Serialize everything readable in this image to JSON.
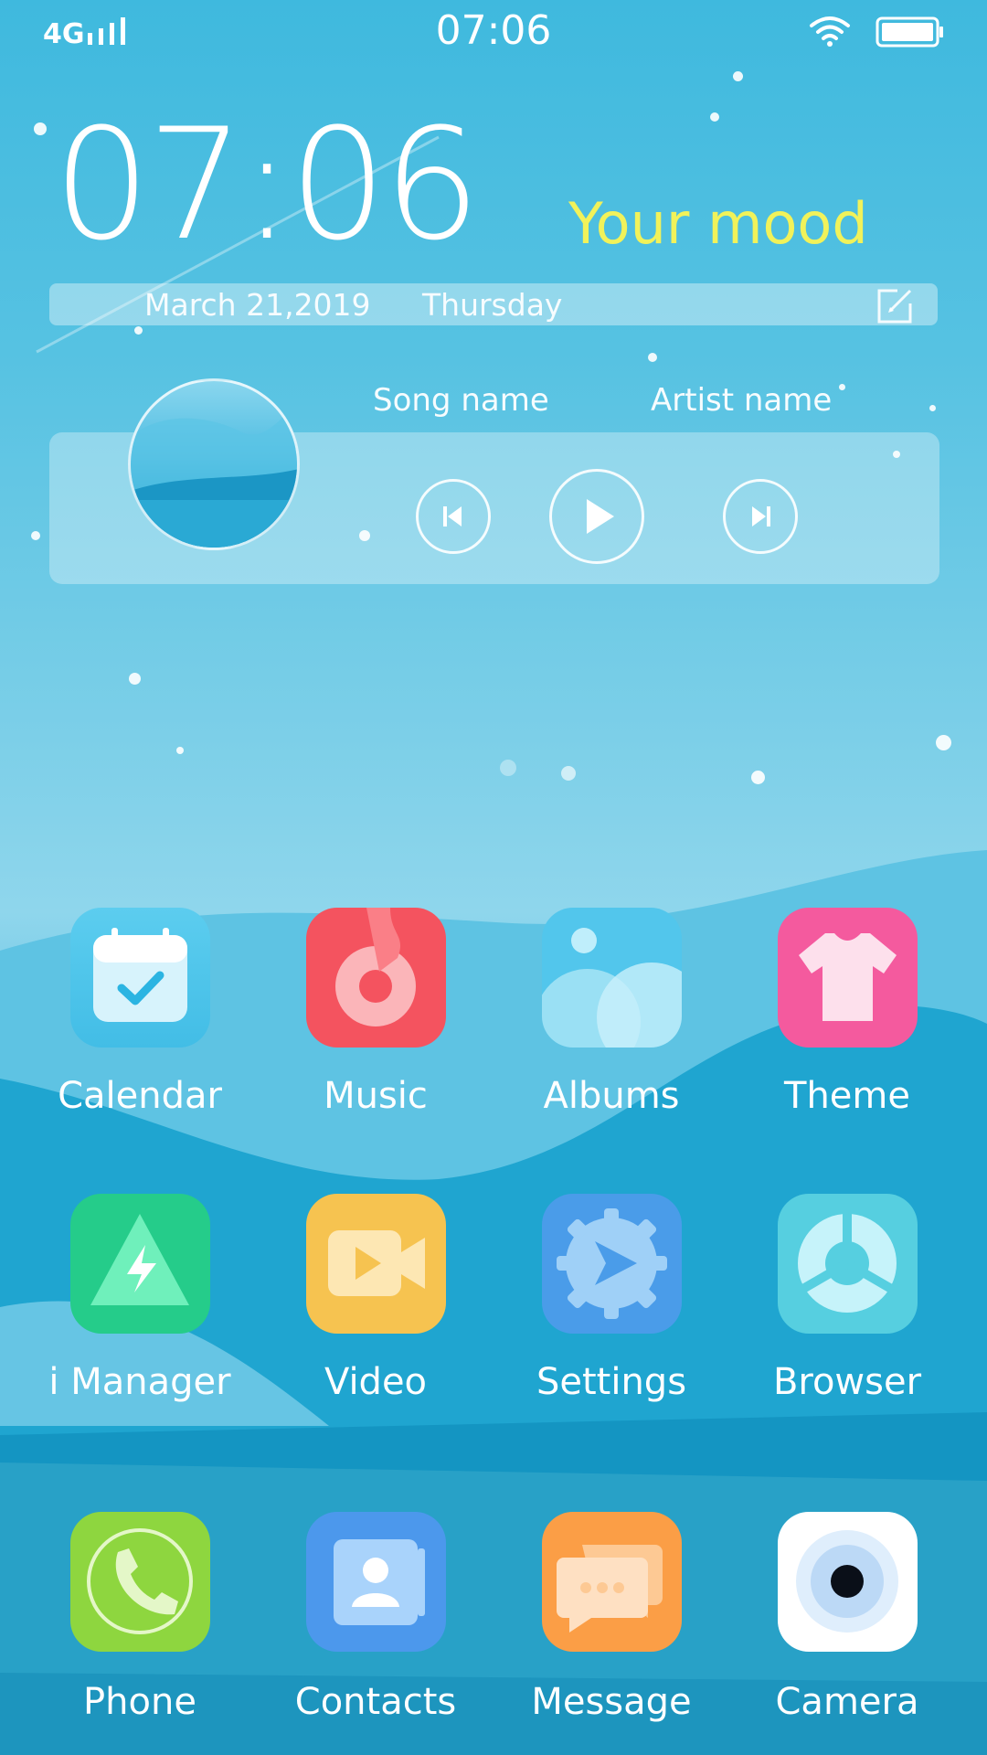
{
  "status_bar": {
    "network": "4G",
    "time": "07:06"
  },
  "clock_widget": {
    "time": "07:06",
    "mood": "Your mood",
    "date": "March 21,2019",
    "weekday": "Thursday"
  },
  "music_widget": {
    "song": "Song name",
    "artist": "Artist name"
  },
  "apps": {
    "row1": [
      "Calendar",
      "Music",
      "Albums",
      "Theme"
    ],
    "row2": [
      "i Manager",
      "Video",
      "Settings",
      "Browser"
    ]
  },
  "dock": [
    "Phone",
    "Contacts",
    "Message",
    "Camera"
  ],
  "colors": {
    "mood_text": "#f1f25a",
    "calendar": "#4cc5ea",
    "music": "#f4535f",
    "albums": "#52c6ec",
    "theme": "#f45a9e",
    "imanager": "#25cc8a",
    "video": "#f6c350",
    "settings": "#4a9ce9",
    "browser": "#56cfe0",
    "phone": "#8ed63f",
    "contacts": "#4c98ec",
    "message": "#fb9e46",
    "camera": "#ffffff"
  }
}
